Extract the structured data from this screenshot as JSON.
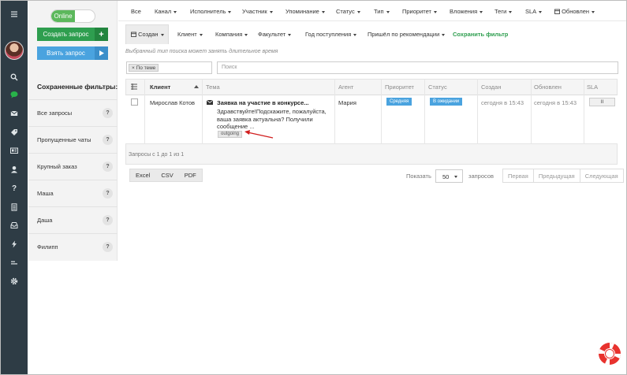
{
  "rail": {
    "items": [
      "menu-icon",
      "search-icon",
      "chat-icon",
      "mail-icon",
      "tag-icon",
      "id-card-icon",
      "user-icon",
      "help-icon",
      "document-icon",
      "inbox-icon",
      "bolt-icon",
      "align-icon",
      "gear-icon"
    ],
    "chat_color": "#28b34a"
  },
  "status_toggle": {
    "label": "Online",
    "on": true
  },
  "actions": {
    "create": "Создать запрос",
    "create_icon": "+",
    "take": "Взять запрос"
  },
  "saved_filters": {
    "title": "Сохраненные фильтры:",
    "items": [
      {
        "label": "Все запросы"
      },
      {
        "label": "Пропущенные чаты"
      },
      {
        "label": "Крупный заказ"
      },
      {
        "label": "Маша"
      },
      {
        "label": "Даша"
      },
      {
        "label": "Филипп"
      }
    ],
    "help_mark": "?"
  },
  "filters_row1": [
    "Все",
    "Канал",
    "Исполнитель",
    "Участник",
    "Упоминание",
    "Статус",
    "Тип",
    "Приоритет",
    "Вложения",
    "Теги",
    "SLA",
    "Обновлен"
  ],
  "filters_row2": [
    "Создан",
    "Клиент",
    "Компания",
    "Факультет",
    "Год поступления",
    "Пришёл по рекомендации"
  ],
  "save_filter": "Сохранить фильтр",
  "hint": "Выбранный тип поиска может занять длительное время",
  "search": {
    "tag": "× По теме",
    "placeholder": "Поиск"
  },
  "table": {
    "headers": [
      "Клиент",
      "Тема",
      "Агент",
      "Приоритет",
      "Статус",
      "Создан",
      "Обновлен",
      "SLA"
    ],
    "row": {
      "client": "Мирослав Котов",
      "subject_title": "Заявка на участие в конкурсе...",
      "subject_body": "Здравствуйте!Подскажите, пожалуйста, ваша заявка актуальна? Получили сообщение ...",
      "tag": "outgoing",
      "agent": "Мария",
      "priority": "Средняя",
      "status": "В ожидании",
      "created": "сегодня в 15:43",
      "updated": "сегодня в 15:43",
      "sla": "II"
    },
    "footer": "Запросы с 1 до 1 из 1"
  },
  "export": [
    "Excel",
    "CSV",
    "PDF"
  ],
  "page_size": {
    "label": "Показать",
    "value": "50",
    "suffix": "запросов"
  },
  "pager": [
    "Первая",
    "Предыдущая",
    "Следующая"
  ],
  "colors": {
    "green": "#2e9e4f",
    "blue": "#4aa3df",
    "rail": "#2e3c45",
    "arrow": "#d11f1f"
  }
}
